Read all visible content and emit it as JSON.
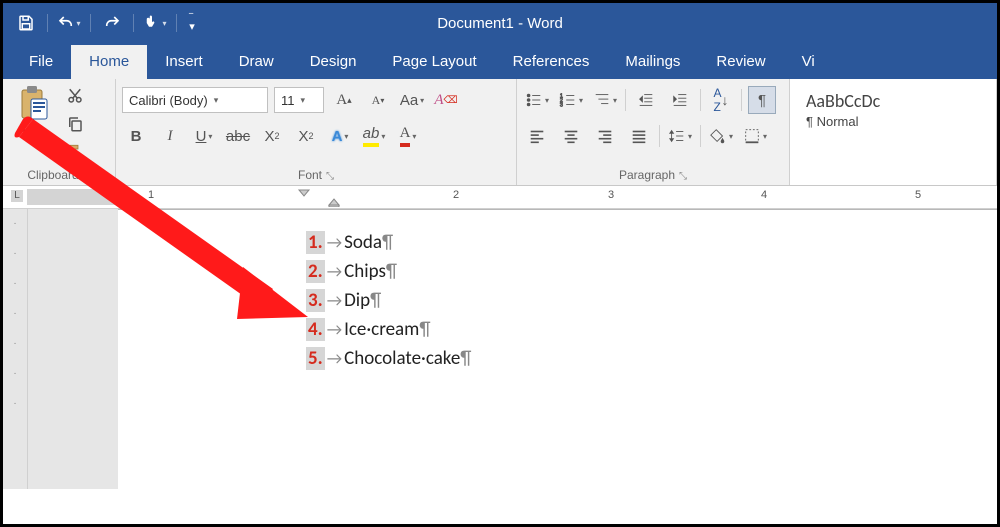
{
  "app": {
    "title": "Document1 - Word"
  },
  "tabs": [
    "File",
    "Home",
    "Insert",
    "Draw",
    "Design",
    "Page Layout",
    "References",
    "Mailings",
    "Review",
    "Vi"
  ],
  "active_tab": 1,
  "font": {
    "name": "Calibri (Body)",
    "size": "11"
  },
  "groups": {
    "clipboard": "Clipboard",
    "font": "Font",
    "paragraph": "Paragraph",
    "paste": "Paste"
  },
  "styles": {
    "preview": "AaBbCcDc",
    "name": "¶ Normal"
  },
  "ruler": [
    "1",
    "2",
    "3",
    "4",
    "5"
  ],
  "list": [
    {
      "n": "1.",
      "t": "Soda"
    },
    {
      "n": "2.",
      "t": "Chips"
    },
    {
      "n": "3.",
      "t": "Dip"
    },
    {
      "n": "4.",
      "t": "Ice·cream"
    },
    {
      "n": "5.",
      "t": "Chocolate·cake"
    }
  ]
}
